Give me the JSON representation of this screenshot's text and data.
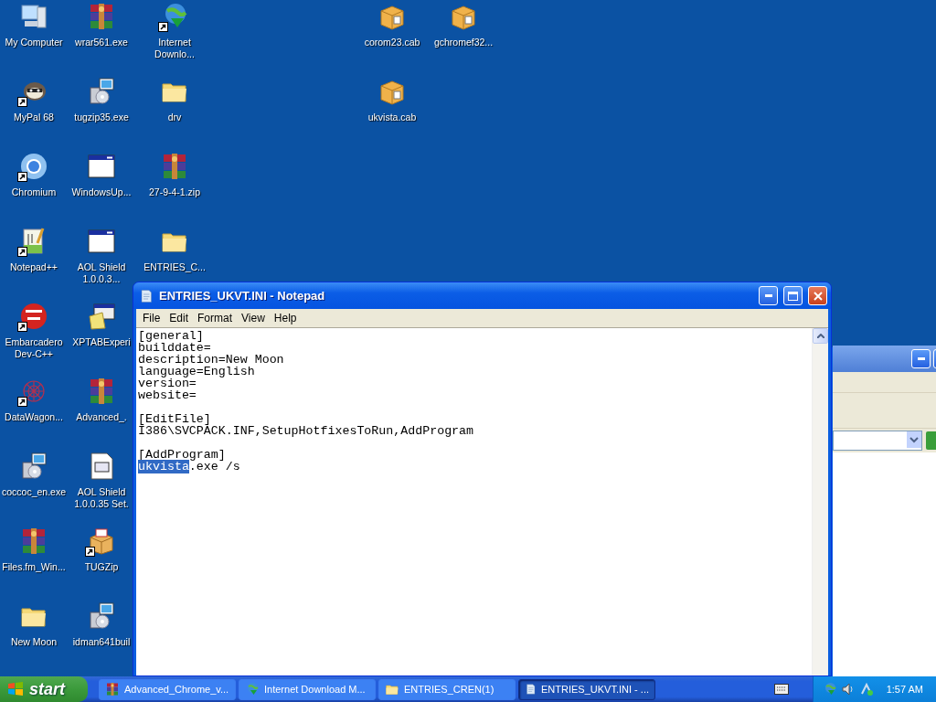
{
  "desktop": {
    "columns": [
      [
        {
          "label": "My Computer",
          "kind": "computer",
          "shortcut": false
        },
        {
          "label": "MyPal 68",
          "kind": "raccoon",
          "shortcut": true
        },
        {
          "label": "Chromium",
          "kind": "chromium",
          "shortcut": true
        },
        {
          "label": "Notepad++",
          "kind": "notepadpp",
          "shortcut": true
        },
        {
          "label": "Embarcadero Dev-C++",
          "kind": "devcpp",
          "shortcut": true
        },
        {
          "label": "DataWagon...",
          "kind": "datawagon",
          "shortcut": true
        },
        {
          "label": "coccoc_en.exe",
          "kind": "setup",
          "shortcut": false
        },
        {
          "label": "Files.fm_Win...",
          "kind": "winrar",
          "shortcut": false
        },
        {
          "label": "New Moon",
          "kind": "folder",
          "shortcut": false
        }
      ],
      [
        {
          "label": "wrar561.exe",
          "kind": "winrar",
          "shortcut": false
        },
        {
          "label": "tugzip35.exe",
          "kind": "setup",
          "shortcut": false
        },
        {
          "label": "WindowsUp...",
          "kind": "window",
          "shortcut": false
        },
        {
          "label": "AOL Shield 1.0.0.3...",
          "kind": "window",
          "shortcut": false
        },
        {
          "label": "XPTABExperi",
          "kind": "xptab",
          "shortcut": false
        },
        {
          "label": "Advanced_.",
          "kind": "winrar",
          "shortcut": false
        },
        {
          "label": "AOL Shield 1.0.0.35 Set.",
          "kind": "document",
          "shortcut": false
        },
        {
          "label": "TUGZip",
          "kind": "box",
          "shortcut": true
        },
        {
          "label": "idman641buil",
          "kind": "setup",
          "shortcut": false
        }
      ],
      [
        {
          "label": "Internet Downlo...",
          "kind": "globe",
          "shortcut": true
        },
        {
          "label": "drv",
          "kind": "folder",
          "shortcut": false
        },
        {
          "label": "27-9-4-1.zip",
          "kind": "winrar",
          "shortcut": false
        },
        {
          "label": "ENTRIES_C...",
          "kind": "folder",
          "shortcut": false
        }
      ]
    ],
    "far_columns": [
      [
        {
          "label": "corom23.cab",
          "kind": "cab",
          "shortcut": false
        },
        {
          "label": "ukvista.cab",
          "kind": "cab",
          "shortcut": false
        }
      ],
      [
        {
          "label": "gchromef32...",
          "kind": "cab",
          "shortcut": false
        }
      ]
    ]
  },
  "notepad": {
    "title": "ENTRIES_UKVT.INI - Notepad",
    "menu": [
      "File",
      "Edit",
      "Format",
      "View",
      "Help"
    ],
    "lines": [
      {
        "kind": "text",
        "segments": [
          {
            "text": "[general]",
            "selected": false
          }
        ]
      },
      {
        "kind": "text",
        "segments": [
          {
            "text": "builddate=",
            "selected": false
          }
        ]
      },
      {
        "kind": "text",
        "segments": [
          {
            "text": "description=New Moon",
            "selected": false
          }
        ]
      },
      {
        "kind": "text",
        "segments": [
          {
            "text": "language=English",
            "selected": false
          }
        ]
      },
      {
        "kind": "text",
        "segments": [
          {
            "text": "version=",
            "selected": false
          }
        ]
      },
      {
        "kind": "text",
        "segments": [
          {
            "text": "website=",
            "selected": false
          }
        ]
      },
      {
        "kind": "blank"
      },
      {
        "kind": "text",
        "segments": [
          {
            "text": "[EditFile]",
            "selected": false
          }
        ]
      },
      {
        "kind": "text",
        "segments": [
          {
            "text": "I386\\SVCPACK.INF,SetupHotfixesToRun,AddProgram",
            "selected": false
          }
        ]
      },
      {
        "kind": "blank"
      },
      {
        "kind": "text",
        "segments": [
          {
            "text": "[AddProgram]",
            "selected": false
          }
        ]
      },
      {
        "kind": "text",
        "segments": [
          {
            "text": "ukvista",
            "selected": true
          },
          {
            "text": ".exe /s",
            "selected": false
          }
        ]
      }
    ]
  },
  "taskbar": {
    "start": "start",
    "tasks": [
      {
        "label": "Advanced_Chrome_v...",
        "kind": "winrar",
        "selected": false
      },
      {
        "label": "Internet Download M...",
        "kind": "globe",
        "selected": false
      },
      {
        "label": "ENTRIES_CREN(1)",
        "kind": "folder",
        "selected": false
      },
      {
        "label": "ENTRIES_UKVT.INI - ...",
        "kind": "notepad",
        "selected": true
      }
    ],
    "clock": "1:57 AM"
  }
}
